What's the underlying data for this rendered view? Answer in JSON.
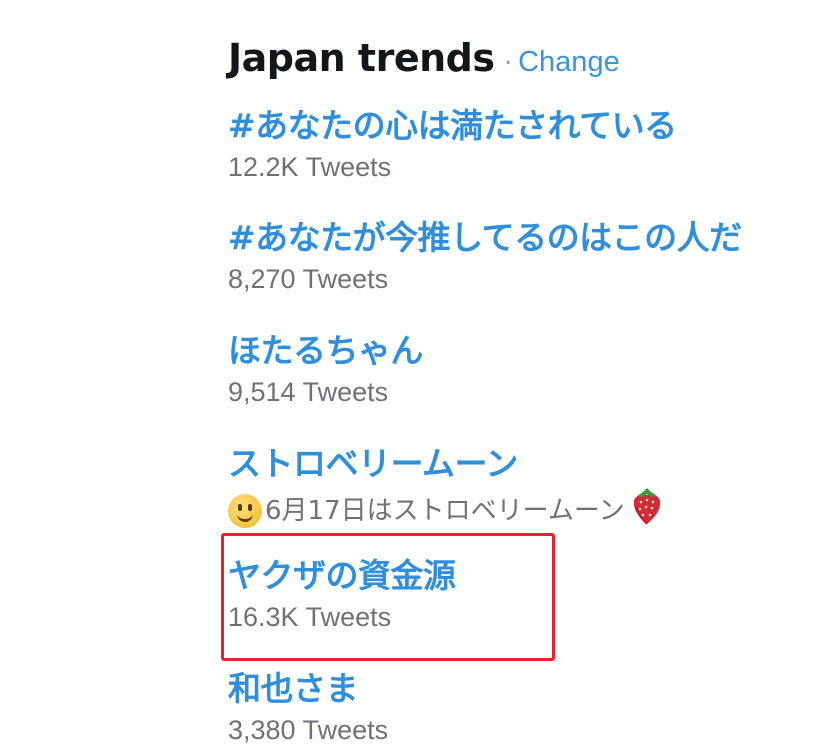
{
  "trends": {
    "title": "Japan trends",
    "separator": "·",
    "change_label": "Change",
    "items": [
      {
        "name": "#あなたの心は満たされている",
        "meta": "12.2K Tweets"
      },
      {
        "name": "#あなたが今推してるのはこの人だ",
        "meta": "8,270 Tweets"
      },
      {
        "name": "ほたるちゃん",
        "meta": "9,514 Tweets"
      },
      {
        "name": "ストロベリームーン",
        "description": "6月17日はストロベリームーン",
        "description_icons": [
          "smiling-face-icon",
          "strawberry-icon"
        ]
      },
      {
        "name": "ヤクザの資金源",
        "meta": "16.3K Tweets",
        "highlighted": true
      },
      {
        "name": "和也さま",
        "meta": "3,380 Tweets"
      }
    ]
  },
  "colors": {
    "title": "#14171a",
    "link": "#2f8fdb",
    "meta": "#6e7277",
    "highlight": "#e8232b"
  }
}
